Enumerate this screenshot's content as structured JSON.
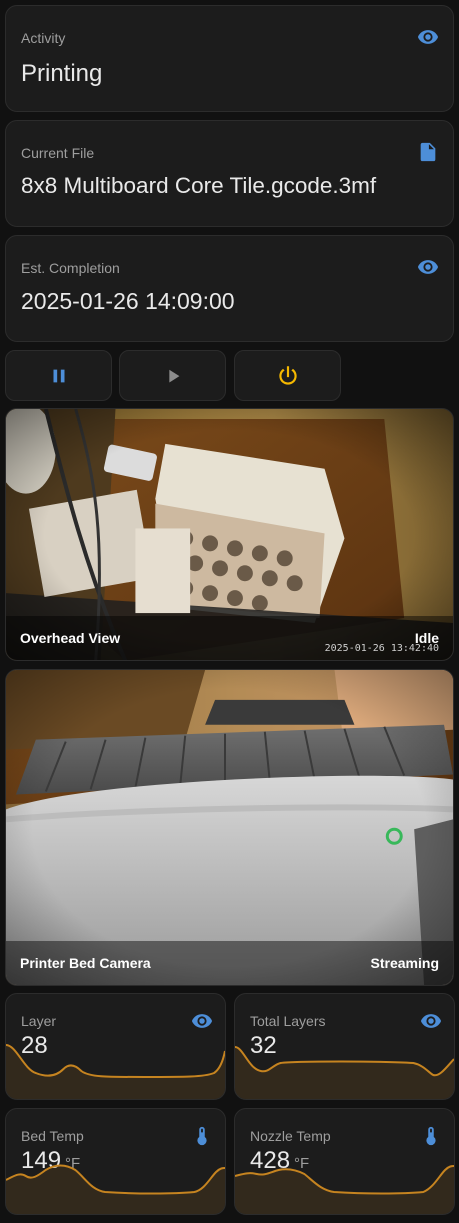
{
  "activity": {
    "label": "Activity",
    "value": "Printing",
    "icon": "eye-icon"
  },
  "current_file": {
    "label": "Current File",
    "value": "8x8 Multiboard Core Tile.gcode.3mf",
    "icon": "file-icon"
  },
  "completion": {
    "label": "Est. Completion",
    "value": "2025-01-26 14:09:00",
    "icon": "eye-icon"
  },
  "controls": {
    "pause": {
      "icon": "pause-icon",
      "color": "#4d8ed8"
    },
    "resume": {
      "icon": "play-icon",
      "color": "#8c8c8c"
    },
    "stop": {
      "icon": "power-icon",
      "color": "#f5b800"
    }
  },
  "cameras": [
    {
      "name": "Overhead View",
      "status": "Idle",
      "timestamp": "2025-01-26 13:42:40"
    },
    {
      "name": "Printer Bed Camera",
      "status": "Streaming",
      "timestamp": ""
    }
  ],
  "sensors": {
    "layer": {
      "label": "Layer",
      "value": "28",
      "unit": "",
      "icon": "eye-icon"
    },
    "total_layers": {
      "label": "Total Layers",
      "value": "32",
      "unit": "",
      "icon": "eye-icon"
    },
    "bed_temp": {
      "label": "Bed Temp",
      "value": "149",
      "unit": "°F",
      "icon": "thermometer-icon"
    },
    "nozzle_temp": {
      "label": "Nozzle Temp",
      "value": "428",
      "unit": "°F",
      "icon": "thermometer-icon"
    }
  },
  "colors": {
    "accent": "#4d8ed8",
    "graph": "#c68420",
    "warning": "#f5b800"
  }
}
